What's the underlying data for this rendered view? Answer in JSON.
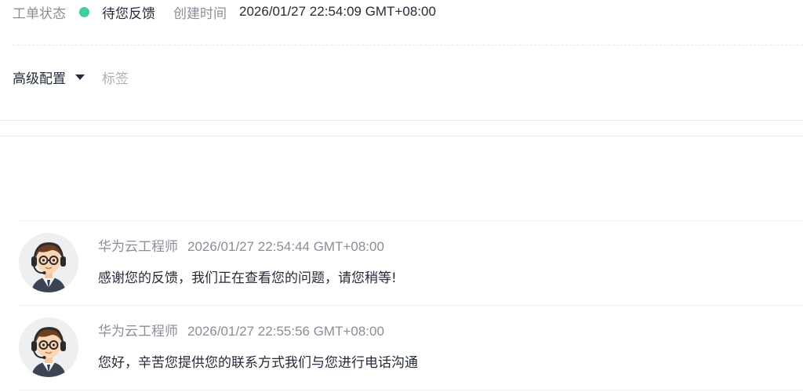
{
  "ticket": {
    "status_label": "工单状态",
    "status_value": "待您反馈",
    "status_color": "#3ccfa0",
    "created_label": "创建时间",
    "created_value": "2026/01/27 22:54:09 GMT+08:00"
  },
  "config": {
    "advanced_label": "高级配置",
    "tag_label": "标签"
  },
  "messages": [
    {
      "author": "华为云工程师",
      "time": "2026/01/27 22:54:44 GMT+08:00",
      "text": "感谢您的反馈，我们正在查看您的问题，请您稍等!",
      "avatar_icon": "engineer-headset-avatar"
    },
    {
      "author": "华为云工程师",
      "time": "2026/01/27 22:55:56 GMT+08:00",
      "text": "您好，辛苦您提供您的联系方式我们与您进行电话沟通",
      "avatar_icon": "engineer-headset-avatar"
    }
  ]
}
